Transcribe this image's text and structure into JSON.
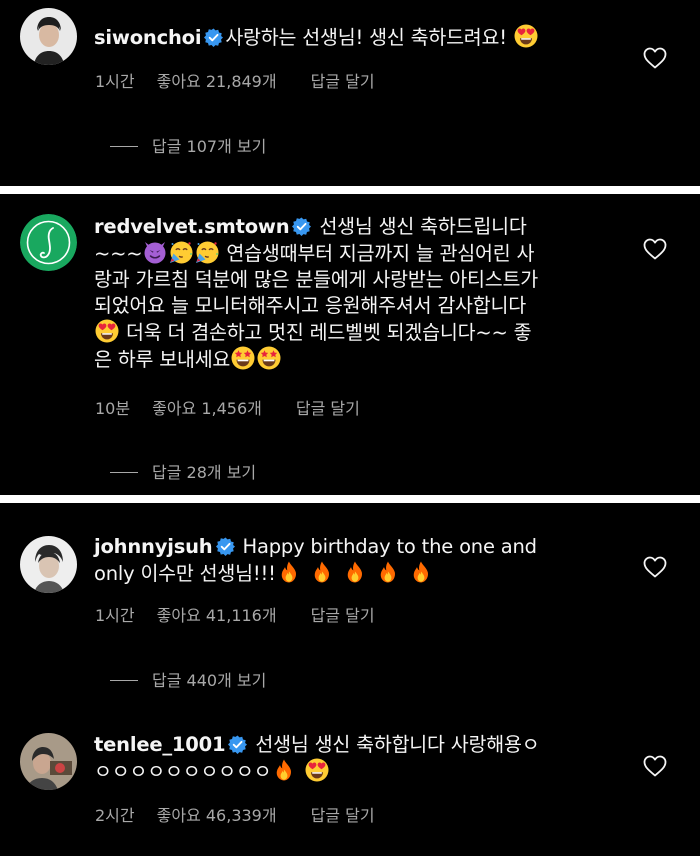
{
  "comments": [
    {
      "username": "siwonchoi",
      "text": "사랑하는 선생님! 생신 축하드려요!",
      "time": "1시간",
      "likes": "좋아요 21,849개",
      "reply": "답글 달기",
      "view_replies": "답글 107개 보기",
      "emojis": [
        "heart-eyes"
      ]
    },
    {
      "username": "redvelvet.smtown",
      "text_line1": "선생님 생신 축하드립니다",
      "text_line2_prefix": "~~~",
      "text_line2": "연습생때부터 지금까지 늘 관심어린 사",
      "text_line3": "랑과 가르침 덕분에 많은 분들에게 사랑받는 아티스트가",
      "text_line4": "되었어요 늘 모니터해주시고 응원해주셔서 감사합니다",
      "text_line5": "더욱 더 겸손하고 멋진 레드벨벳 되겠습니다~~ 좋",
      "text_line6": "은 하루 보내세요",
      "time": "10분",
      "likes": "좋아요 1,456개",
      "reply": "답글 달기",
      "view_replies": "답글 28개 보기",
      "emojis": [
        "smiling-imp",
        "partying-face",
        "partying-face",
        "heart-eyes",
        "star-struck",
        "star-struck"
      ]
    },
    {
      "username": "johnnyjsuh",
      "text_line1": "Happy birthday to the one and",
      "text_line2": "only 이수만 선생님!!!",
      "time": "1시간",
      "likes": "좋아요 41,116개",
      "reply": "답글 달기",
      "view_replies": "답글 440개 보기",
      "emojis": [
        "fire",
        "fire",
        "fire",
        "fire",
        "fire"
      ]
    },
    {
      "username": "tenlee_1001",
      "text_line1": "선생님 생신 축하합니다 사랑해용ㅇ",
      "text_line2": "ㅇㅇㅇㅇㅇㅇㅇㅇㅇㅇ",
      "time": "2시간",
      "likes": "좋아요 46,339개",
      "reply": "답글 달기",
      "emojis": [
        "fire",
        "heart-eyes"
      ]
    }
  ],
  "colors": {
    "background": "#000000",
    "text": "#f5f5f5",
    "meta": "#a8a8a8",
    "verified": "#3897f0",
    "divider": "#ffffff"
  }
}
